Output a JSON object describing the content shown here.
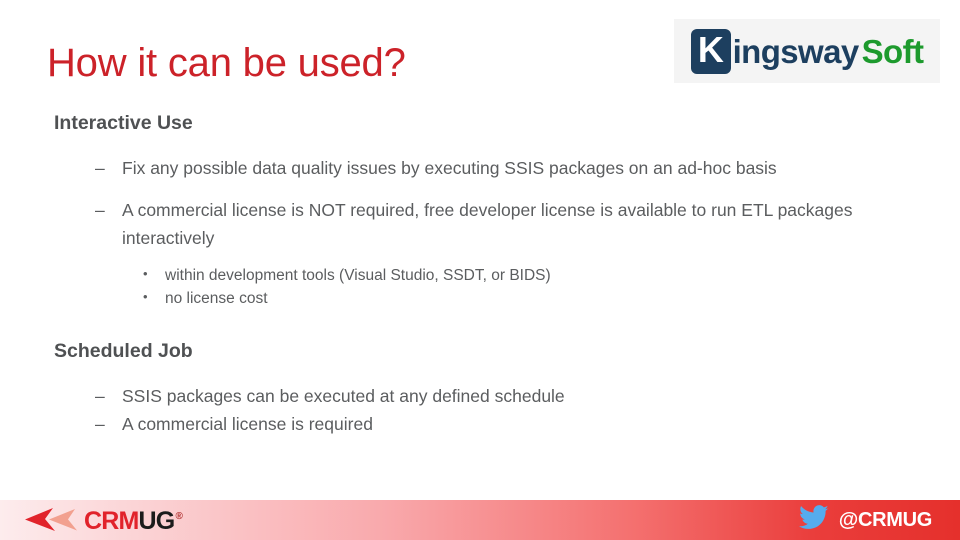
{
  "slide": {
    "title": "How it can be used?",
    "title_color": "#CC2229",
    "background_color": "#FFFFFF"
  },
  "logo": {
    "name": "kingswaysoft-logo",
    "k_letter": "K",
    "word_part1": "ingsway",
    "word_part2": "Soft",
    "navy_color": "#1D3F5F",
    "green_color": "#1D9A2D"
  },
  "body": {
    "sections": [
      {
        "heading": "Interactive Use",
        "bullets": [
          {
            "marker": "–",
            "text": "Fix any possible data quality issues by executing SSIS packages on an ad-hoc basis",
            "subbullets": []
          },
          {
            "marker": "–",
            "text": "A commercial license is NOT required, free developer license is available to run ETL packages interactively",
            "subbullets": [
              {
                "marker": "•",
                "text": "within development tools (Visual Studio, SSDT, or BIDS)"
              },
              {
                "marker": "•",
                "text": "no license cost"
              }
            ]
          }
        ]
      },
      {
        "heading": "Scheduled Job",
        "bullets": [
          {
            "marker": "–",
            "text": "SSIS packages can be executed at any defined schedule",
            "subbullets": []
          },
          {
            "marker": "–",
            "text": "A commercial license is required",
            "subbullets": []
          }
        ]
      }
    ]
  },
  "footer": {
    "crmug": {
      "word_red": "CRM",
      "word_black": "UG",
      "registered": "®",
      "red_color": "#E1232B"
    },
    "twitter": {
      "handle": "@CRMUG",
      "icon_color": "#55ACEE"
    },
    "gradient_start": "#FDECED",
    "gradient_end": "#E5302C"
  }
}
